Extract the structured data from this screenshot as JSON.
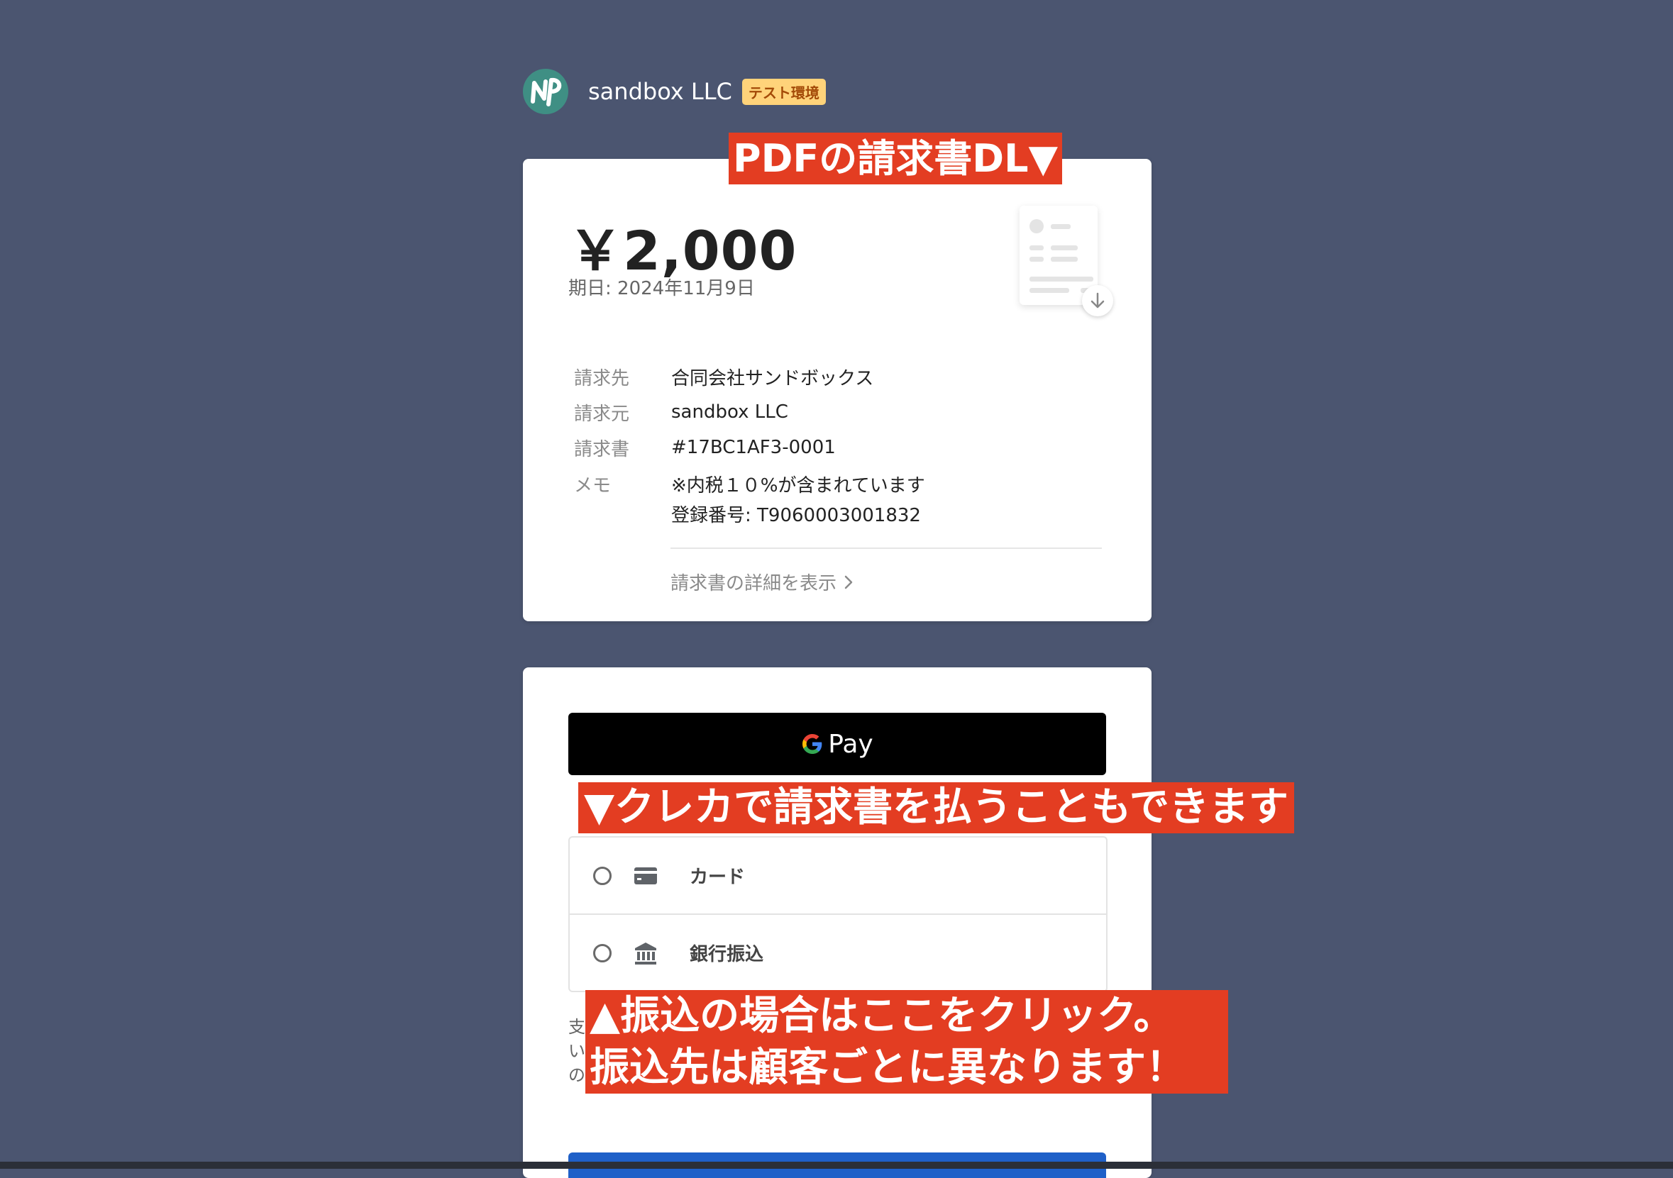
{
  "header": {
    "company_name": "sandbox LLC",
    "env_badge": "テスト環境",
    "logo_icon": "np-logo-icon"
  },
  "invoice": {
    "amount": "￥2,000",
    "due_date": "期日: 2024年11月9日",
    "pdf_icon": "pdf-document-icon",
    "rows": [
      {
        "label": "請求先",
        "value": "合同会社サンドボックス"
      },
      {
        "label": "請求元",
        "value": "sandbox LLC"
      },
      {
        "label": "請求書",
        "value": "#17BC1AF3-0001"
      }
    ],
    "memo": {
      "label": "メモ",
      "line1": "※内税１０%が含まれています",
      "line2": "登録番号: T9060003001832"
    },
    "details_link": "請求書の詳細を表示"
  },
  "payment": {
    "gpay_label": "Pay",
    "methods": [
      {
        "label": "カード",
        "icon": "credit-card-icon"
      },
      {
        "label": "銀行振込",
        "icon": "bank-icon"
      }
    ],
    "fine_print": [
      "支",
      "い",
      "の"
    ]
  },
  "annotations": {
    "pdf": "PDFの請求書DL▼",
    "card": "▼クレカで請求書を払うこともできます",
    "bank_line1": "▲振込の場合はここをクリック。",
    "bank_line2": "振込先は顧客ごとに異なります！"
  },
  "colors": {
    "background": "#4b5570",
    "annotation": "#e33d22",
    "badge": "#ffd37a",
    "gpay": "#000000",
    "primary_button": "#1f60c8"
  }
}
